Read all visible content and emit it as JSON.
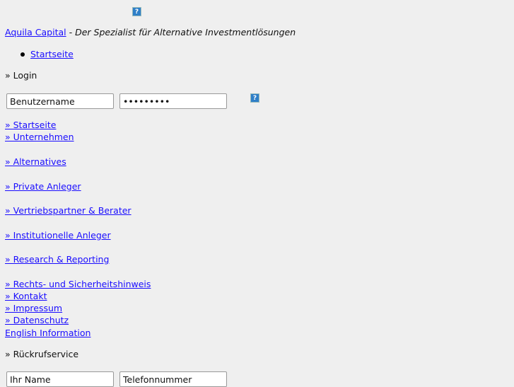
{
  "header": {
    "help_icon": "question-mark-icon",
    "brand_link": "Aquila Capital",
    "tagline": "- Der Spezialist für Alternative Investmentlösungen"
  },
  "top_nav": [
    {
      "label": "Startseite"
    }
  ],
  "login": {
    "heading": "» Login",
    "username_value": "Benutzername",
    "password_value": "•••••••••",
    "help_icon": "question-mark-icon"
  },
  "nav": [
    {
      "label": "» Startseite"
    },
    {
      "label": "» Unternehmen"
    },
    {
      "label": "» Alternatives"
    },
    {
      "label": "» Private Anleger"
    },
    {
      "label": "» Vertriebspartner & Berater"
    },
    {
      "label": "» Institutionelle Anleger"
    },
    {
      "label": "» Research & Reporting"
    },
    {
      "label": "» Rechts- und Sicherheitshinweis"
    },
    {
      "label": "» Kontakt"
    },
    {
      "label": "» Impressum"
    },
    {
      "label": "» Datenschutz"
    },
    {
      "label": "English Information"
    }
  ],
  "callback": {
    "heading": "» Rückrufservice",
    "name_value": "Ihr Name",
    "phone_value": "Telefonnummer"
  }
}
